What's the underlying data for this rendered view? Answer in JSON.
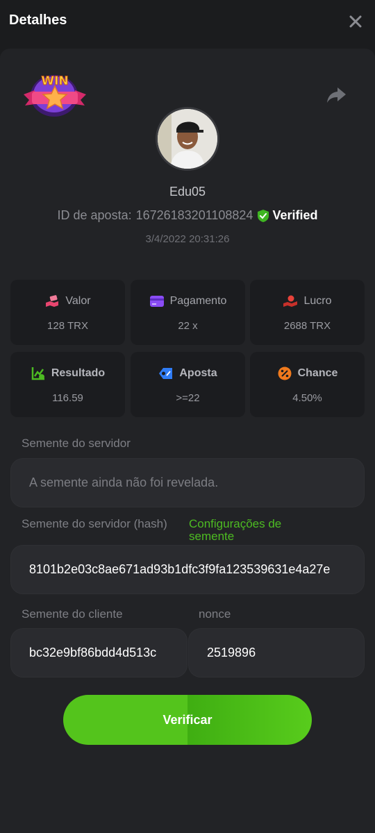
{
  "header": {
    "title": "Detalhes"
  },
  "player": {
    "username": "Edu05",
    "bet_id_label": "ID de aposta:",
    "bet_id": "16726183201108824",
    "verified_label": "Verified",
    "datetime": "3/4/2022 20:31:26"
  },
  "badge": {
    "text": "WIN"
  },
  "stats": [
    {
      "label": "Valor",
      "value": "128 TRX",
      "icon": "money-hand-icon",
      "color": "#e8456f"
    },
    {
      "label": "Pagamento",
      "value": "22 x",
      "icon": "card-icon",
      "color": "#8a4cf5"
    },
    {
      "label": "Lucro",
      "value": "2688 TRX",
      "icon": "profit-hand-icon",
      "color": "#e8423a"
    },
    {
      "label": "Resultado",
      "value": "116.59",
      "icon": "chart-check-icon",
      "color": "#4dbb22"
    },
    {
      "label": "Aposta",
      "value": ">=22",
      "icon": "tag-icon",
      "color": "#2f7cf5"
    },
    {
      "label": "Chance",
      "value": "4.50%",
      "icon": "percent-icon",
      "color": "#f07a1d"
    }
  ],
  "seeds": {
    "server_seed_label": "Semente do servidor",
    "server_seed_value": "A semente ainda não foi revelada.",
    "server_hash_label": "Semente do servidor (hash)",
    "seed_settings_link": "Configurações de semente",
    "server_hash_value": "8101b2e03c8ae671ad93b1dfc3f9fa123539631e4a27e",
    "client_seed_label": "Semente do cliente",
    "client_seed_value": "bc32e9bf86bdd4d513c",
    "nonce_label": "nonce",
    "nonce_value": "2519896"
  },
  "actions": {
    "verify_label": "Verificar"
  },
  "colors": {
    "accent": "#54c41c",
    "panel": "#222326",
    "background": "#1b1c1e"
  }
}
